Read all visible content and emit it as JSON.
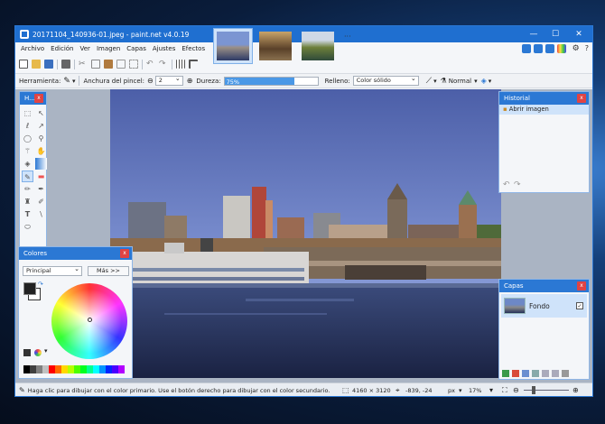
{
  "window": {
    "title": "20171104_140936-01.jpeg - paint.net v4.0.19",
    "minimize": "—",
    "maximize": "☐",
    "close": "✕"
  },
  "menu": [
    "Archivo",
    "Edición",
    "Ver",
    "Imagen",
    "Capas",
    "Ajustes",
    "Efectos"
  ],
  "more_images": "···",
  "toolbar": {
    "tool_label": "Herramienta:",
    "brush_width_label": "Anchura del pincel:",
    "brush_width": "2",
    "hardness_label": "Dureza:",
    "hardness_value": "75%",
    "hardness_fraction": 0.75,
    "fill_label": "Relleno:",
    "fill_value": "Color sólido",
    "blend_value": "Normal"
  },
  "tools_panel": {
    "title": "H...",
    "close": "x",
    "icons": [
      "rectangle-select",
      "move-selection",
      "lasso-select",
      "move-selection-2",
      "ellipse-select",
      "zoom",
      "magic-wand",
      "pan",
      "paint-bucket",
      "gradient",
      "paintbrush",
      "eraser",
      "pencil",
      "color-picker",
      "clone-stamp",
      "recolor",
      "text",
      "line-curve",
      "shapes"
    ]
  },
  "history_panel": {
    "title": "Historial",
    "close": "x",
    "items": [
      "Abrir imagen"
    ],
    "undo": "↶",
    "redo": "↷"
  },
  "colors_panel": {
    "title": "Colores",
    "close": "x",
    "mode": "Principal",
    "more_button": "Más >>"
  },
  "layers_panel": {
    "title": "Capas",
    "close": "x",
    "layers": [
      {
        "name": "Fondo",
        "visible": "✓"
      }
    ]
  },
  "status": {
    "hint": "Haga clic para dibujar con el color primario. Use el botón derecho para dibujar con el color secundario.",
    "size": "4160 × 3120",
    "coords": "-839, -24",
    "units": "px",
    "zoom": "17%"
  },
  "colors": {
    "accent": "#2b78d4",
    "title_bar": "#1f6fd0",
    "selected": "#cfe3fa",
    "close": "#e04343"
  }
}
